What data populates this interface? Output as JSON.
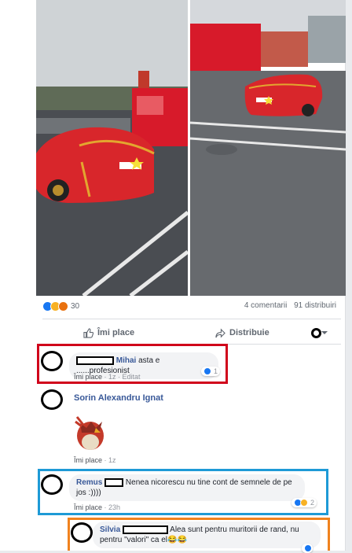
{
  "post": {
    "reaction_count": "30",
    "comments_count": "4 comentarii",
    "shares_count": "91 distribuiri",
    "like_label": "Îmi place",
    "share_label": "Distribuie"
  },
  "comments": [
    {
      "author": "Mihai",
      "text": "asta e ......profesionist",
      "meta_like": "Îmi place",
      "meta_time": "1z",
      "meta_edited": "Editat",
      "reactions": "1",
      "box_color": "#d0021b"
    },
    {
      "author": "Sorin Alexandru Ignat",
      "text": "",
      "meta_like": "Îmi place",
      "meta_time": "1z",
      "sticker": "sticker-bird-facepalm"
    },
    {
      "author": "Remus",
      "text": "Nenea nicorescu nu tine cont de semnele de pe jos :))))",
      "meta_like": "Îmi place",
      "meta_time": "23h",
      "reactions": "2",
      "box_color": "#1e9ad6"
    },
    {
      "author": "Silvia",
      "text": "Alea sunt pentru muritorii de rand, nu pentru \"valori\" ca el😂😂",
      "box_color": "#f0821e"
    }
  ],
  "colors": {
    "accent": "#385898",
    "like_blue": "#1877f2"
  }
}
